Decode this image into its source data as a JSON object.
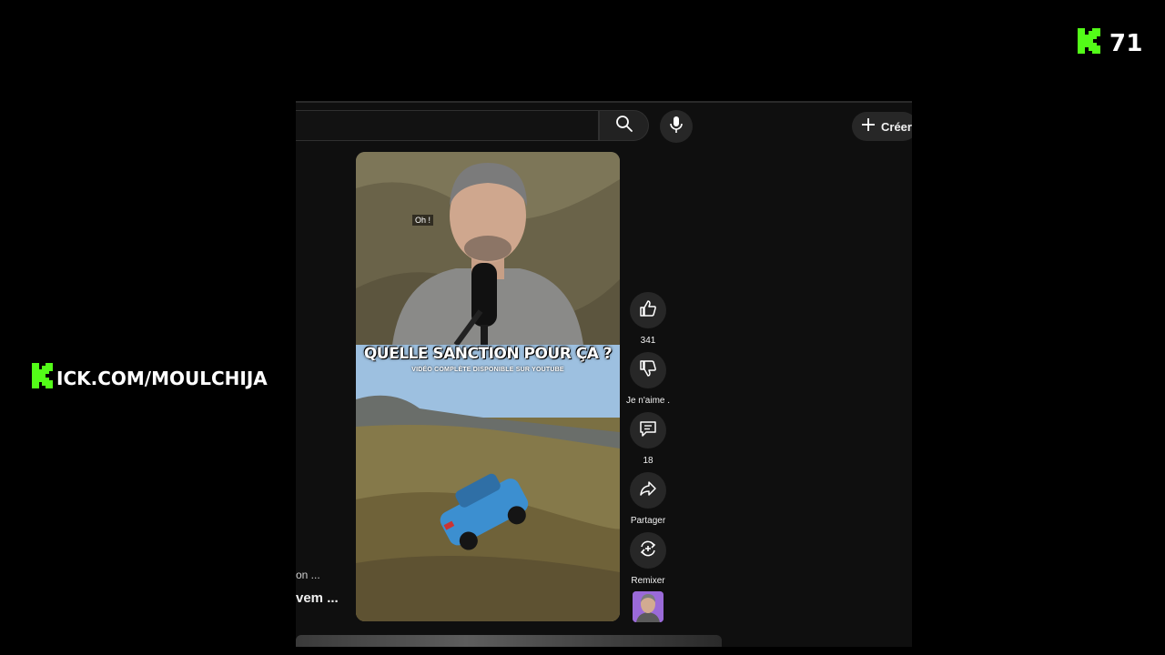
{
  "overlay": {
    "viewer_count": "71",
    "channel_url": "ICK.COM/MOULCHIJA",
    "brand_color": "#53fc18"
  },
  "youtube": {
    "create_label": "Créer",
    "left_meta": "on ...",
    "left_title": "vem ...",
    "short": {
      "caption": "Oh !",
      "headline": "QUELLE SANCTION POUR ÇA ?",
      "subline": "VIDÉO COMPLÈTE DISPONIBLE SUR YOUTUBE"
    },
    "actions": {
      "likes": "341",
      "dislike_label": "Je n'aime .",
      "comments": "18",
      "share_label": "Partager",
      "remix_label": "Remixer"
    },
    "icons": [
      "search-icon",
      "mic-icon",
      "plus-icon",
      "thumbs-up-icon",
      "thumbs-down-icon",
      "comment-icon",
      "share-icon",
      "remix-icon"
    ]
  }
}
